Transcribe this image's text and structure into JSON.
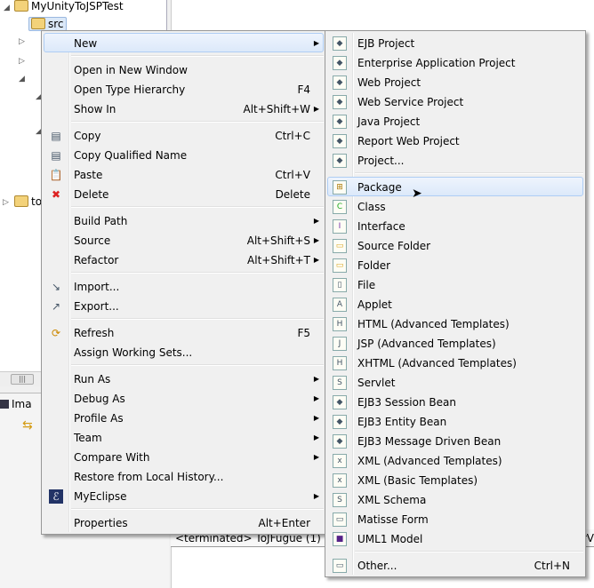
{
  "tree": {
    "project": "MyUnityToJSPTest",
    "src": "src",
    "other": "to"
  },
  "lower_tab": "Ima",
  "console_text": "<terminated> ToJFugue (1) [J",
  "console_right": "orV",
  "context_menu": [
    {
      "label": "New",
      "arrow": true,
      "highlight": true
    },
    {
      "sep": true
    },
    {
      "label": "Open in New Window"
    },
    {
      "label": "Open Type Hierarchy",
      "shortcut": "F4"
    },
    {
      "label": "Show In",
      "shortcut": "Alt+Shift+W",
      "arrow": true
    },
    {
      "sep": true
    },
    {
      "label": "Copy",
      "shortcut": "Ctrl+C",
      "icon": "copy-icon"
    },
    {
      "label": "Copy Qualified Name",
      "icon": "copy-qualified-icon"
    },
    {
      "label": "Paste",
      "shortcut": "Ctrl+V",
      "icon": "paste-icon"
    },
    {
      "label": "Delete",
      "shortcut": "Delete",
      "icon": "delete-icon"
    },
    {
      "sep": true
    },
    {
      "label": "Build Path",
      "arrow": true
    },
    {
      "label": "Source",
      "shortcut": "Alt+Shift+S",
      "arrow": true
    },
    {
      "label": "Refactor",
      "shortcut": "Alt+Shift+T",
      "arrow": true
    },
    {
      "sep": true
    },
    {
      "label": "Import...",
      "icon": "import-icon"
    },
    {
      "label": "Export...",
      "icon": "export-icon"
    },
    {
      "sep": true
    },
    {
      "label": "Refresh",
      "shortcut": "F5",
      "icon": "refresh-icon"
    },
    {
      "label": "Assign Working Sets..."
    },
    {
      "sep": true
    },
    {
      "label": "Run As",
      "arrow": true
    },
    {
      "label": "Debug As",
      "arrow": true
    },
    {
      "label": "Profile As",
      "arrow": true
    },
    {
      "label": "Team",
      "arrow": true
    },
    {
      "label": "Compare With",
      "arrow": true
    },
    {
      "label": "Restore from Local History..."
    },
    {
      "label": "MyEclipse",
      "arrow": true,
      "icon": "myeclipse-icon"
    },
    {
      "sep": true
    },
    {
      "label": "Properties",
      "shortcut": "Alt+Enter"
    }
  ],
  "submenu": [
    {
      "label": "EJB Project",
      "icon": "ejb-project-icon"
    },
    {
      "label": "Enterprise Application Project",
      "icon": "enterprise-project-icon"
    },
    {
      "label": "Web Project",
      "icon": "web-project-icon"
    },
    {
      "label": "Web Service Project",
      "icon": "web-service-project-icon"
    },
    {
      "label": "Java Project",
      "icon": "java-project-icon"
    },
    {
      "label": "Report Web Project",
      "icon": "report-project-icon"
    },
    {
      "label": "Project...",
      "icon": "project-icon"
    },
    {
      "sep": true
    },
    {
      "label": "Package",
      "icon": "package-icon",
      "highlight": true
    },
    {
      "label": "Class",
      "icon": "class-icon"
    },
    {
      "label": "Interface",
      "icon": "interface-icon"
    },
    {
      "label": "Source Folder",
      "icon": "source-folder-icon"
    },
    {
      "label": "Folder",
      "icon": "folder-icon"
    },
    {
      "label": "File",
      "icon": "file-icon"
    },
    {
      "label": "Applet",
      "icon": "applet-icon"
    },
    {
      "label": "HTML (Advanced Templates)",
      "icon": "html-icon"
    },
    {
      "label": "JSP (Advanced Templates)",
      "icon": "jsp-icon"
    },
    {
      "label": "XHTML (Advanced Templates)",
      "icon": "xhtml-icon"
    },
    {
      "label": "Servlet",
      "icon": "servlet-icon"
    },
    {
      "label": "EJB3 Session Bean",
      "icon": "session-bean-icon"
    },
    {
      "label": "EJB3 Entity Bean",
      "icon": "entity-bean-icon"
    },
    {
      "label": "EJB3 Message Driven Bean",
      "icon": "message-bean-icon"
    },
    {
      "label": "XML (Advanced Templates)",
      "icon": "xml-advanced-icon"
    },
    {
      "label": "XML (Basic Templates)",
      "icon": "xml-basic-icon"
    },
    {
      "label": "XML Schema",
      "icon": "xml-schema-icon"
    },
    {
      "label": "Matisse Form",
      "icon": "matisse-form-icon"
    },
    {
      "label": "UML1 Model",
      "icon": "uml-model-icon"
    },
    {
      "sep": true
    },
    {
      "label": "Other...",
      "shortcut": "Ctrl+N",
      "icon": "other-wizard-icon"
    }
  ]
}
